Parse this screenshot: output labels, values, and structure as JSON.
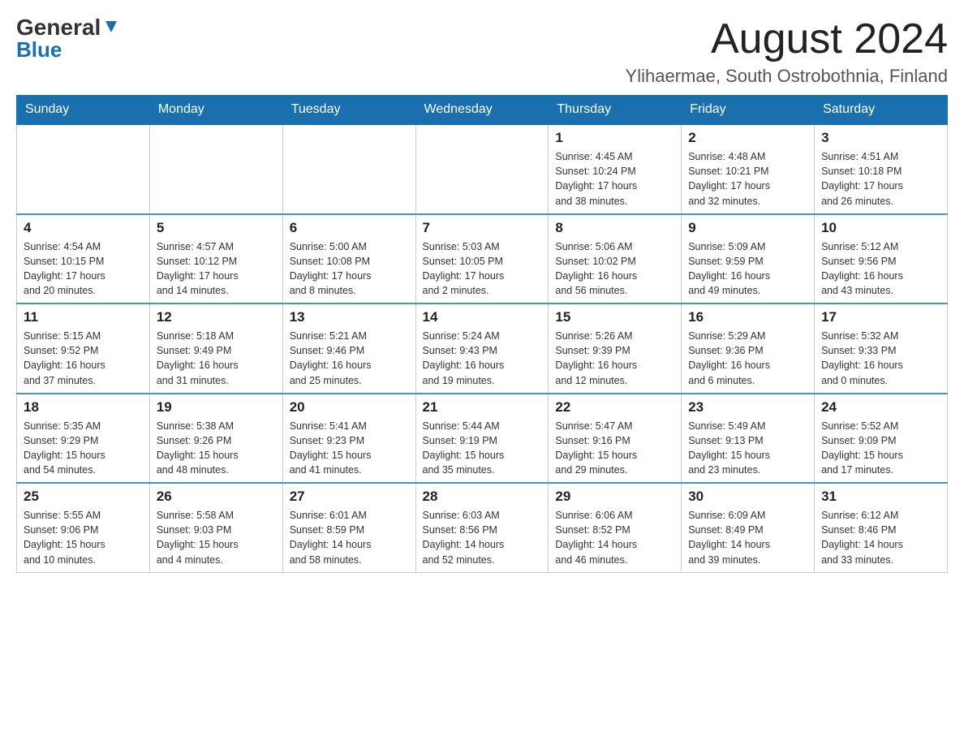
{
  "header": {
    "logo_general": "General",
    "logo_blue": "Blue",
    "month_title": "August 2024",
    "location": "Ylihaermae, South Ostrobothnia, Finland"
  },
  "days_of_week": [
    "Sunday",
    "Monday",
    "Tuesday",
    "Wednesday",
    "Thursday",
    "Friday",
    "Saturday"
  ],
  "weeks": [
    {
      "days": [
        {
          "number": "",
          "info": ""
        },
        {
          "number": "",
          "info": ""
        },
        {
          "number": "",
          "info": ""
        },
        {
          "number": "",
          "info": ""
        },
        {
          "number": "1",
          "info": "Sunrise: 4:45 AM\nSunset: 10:24 PM\nDaylight: 17 hours\nand 38 minutes."
        },
        {
          "number": "2",
          "info": "Sunrise: 4:48 AM\nSunset: 10:21 PM\nDaylight: 17 hours\nand 32 minutes."
        },
        {
          "number": "3",
          "info": "Sunrise: 4:51 AM\nSunset: 10:18 PM\nDaylight: 17 hours\nand 26 minutes."
        }
      ]
    },
    {
      "days": [
        {
          "number": "4",
          "info": "Sunrise: 4:54 AM\nSunset: 10:15 PM\nDaylight: 17 hours\nand 20 minutes."
        },
        {
          "number": "5",
          "info": "Sunrise: 4:57 AM\nSunset: 10:12 PM\nDaylight: 17 hours\nand 14 minutes."
        },
        {
          "number": "6",
          "info": "Sunrise: 5:00 AM\nSunset: 10:08 PM\nDaylight: 17 hours\nand 8 minutes."
        },
        {
          "number": "7",
          "info": "Sunrise: 5:03 AM\nSunset: 10:05 PM\nDaylight: 17 hours\nand 2 minutes."
        },
        {
          "number": "8",
          "info": "Sunrise: 5:06 AM\nSunset: 10:02 PM\nDaylight: 16 hours\nand 56 minutes."
        },
        {
          "number": "9",
          "info": "Sunrise: 5:09 AM\nSunset: 9:59 PM\nDaylight: 16 hours\nand 49 minutes."
        },
        {
          "number": "10",
          "info": "Sunrise: 5:12 AM\nSunset: 9:56 PM\nDaylight: 16 hours\nand 43 minutes."
        }
      ]
    },
    {
      "days": [
        {
          "number": "11",
          "info": "Sunrise: 5:15 AM\nSunset: 9:52 PM\nDaylight: 16 hours\nand 37 minutes."
        },
        {
          "number": "12",
          "info": "Sunrise: 5:18 AM\nSunset: 9:49 PM\nDaylight: 16 hours\nand 31 minutes."
        },
        {
          "number": "13",
          "info": "Sunrise: 5:21 AM\nSunset: 9:46 PM\nDaylight: 16 hours\nand 25 minutes."
        },
        {
          "number": "14",
          "info": "Sunrise: 5:24 AM\nSunset: 9:43 PM\nDaylight: 16 hours\nand 19 minutes."
        },
        {
          "number": "15",
          "info": "Sunrise: 5:26 AM\nSunset: 9:39 PM\nDaylight: 16 hours\nand 12 minutes."
        },
        {
          "number": "16",
          "info": "Sunrise: 5:29 AM\nSunset: 9:36 PM\nDaylight: 16 hours\nand 6 minutes."
        },
        {
          "number": "17",
          "info": "Sunrise: 5:32 AM\nSunset: 9:33 PM\nDaylight: 16 hours\nand 0 minutes."
        }
      ]
    },
    {
      "days": [
        {
          "number": "18",
          "info": "Sunrise: 5:35 AM\nSunset: 9:29 PM\nDaylight: 15 hours\nand 54 minutes."
        },
        {
          "number": "19",
          "info": "Sunrise: 5:38 AM\nSunset: 9:26 PM\nDaylight: 15 hours\nand 48 minutes."
        },
        {
          "number": "20",
          "info": "Sunrise: 5:41 AM\nSunset: 9:23 PM\nDaylight: 15 hours\nand 41 minutes."
        },
        {
          "number": "21",
          "info": "Sunrise: 5:44 AM\nSunset: 9:19 PM\nDaylight: 15 hours\nand 35 minutes."
        },
        {
          "number": "22",
          "info": "Sunrise: 5:47 AM\nSunset: 9:16 PM\nDaylight: 15 hours\nand 29 minutes."
        },
        {
          "number": "23",
          "info": "Sunrise: 5:49 AM\nSunset: 9:13 PM\nDaylight: 15 hours\nand 23 minutes."
        },
        {
          "number": "24",
          "info": "Sunrise: 5:52 AM\nSunset: 9:09 PM\nDaylight: 15 hours\nand 17 minutes."
        }
      ]
    },
    {
      "days": [
        {
          "number": "25",
          "info": "Sunrise: 5:55 AM\nSunset: 9:06 PM\nDaylight: 15 hours\nand 10 minutes."
        },
        {
          "number": "26",
          "info": "Sunrise: 5:58 AM\nSunset: 9:03 PM\nDaylight: 15 hours\nand 4 minutes."
        },
        {
          "number": "27",
          "info": "Sunrise: 6:01 AM\nSunset: 8:59 PM\nDaylight: 14 hours\nand 58 minutes."
        },
        {
          "number": "28",
          "info": "Sunrise: 6:03 AM\nSunset: 8:56 PM\nDaylight: 14 hours\nand 52 minutes."
        },
        {
          "number": "29",
          "info": "Sunrise: 6:06 AM\nSunset: 8:52 PM\nDaylight: 14 hours\nand 46 minutes."
        },
        {
          "number": "30",
          "info": "Sunrise: 6:09 AM\nSunset: 8:49 PM\nDaylight: 14 hours\nand 39 minutes."
        },
        {
          "number": "31",
          "info": "Sunrise: 6:12 AM\nSunset: 8:46 PM\nDaylight: 14 hours\nand 33 minutes."
        }
      ]
    }
  ]
}
